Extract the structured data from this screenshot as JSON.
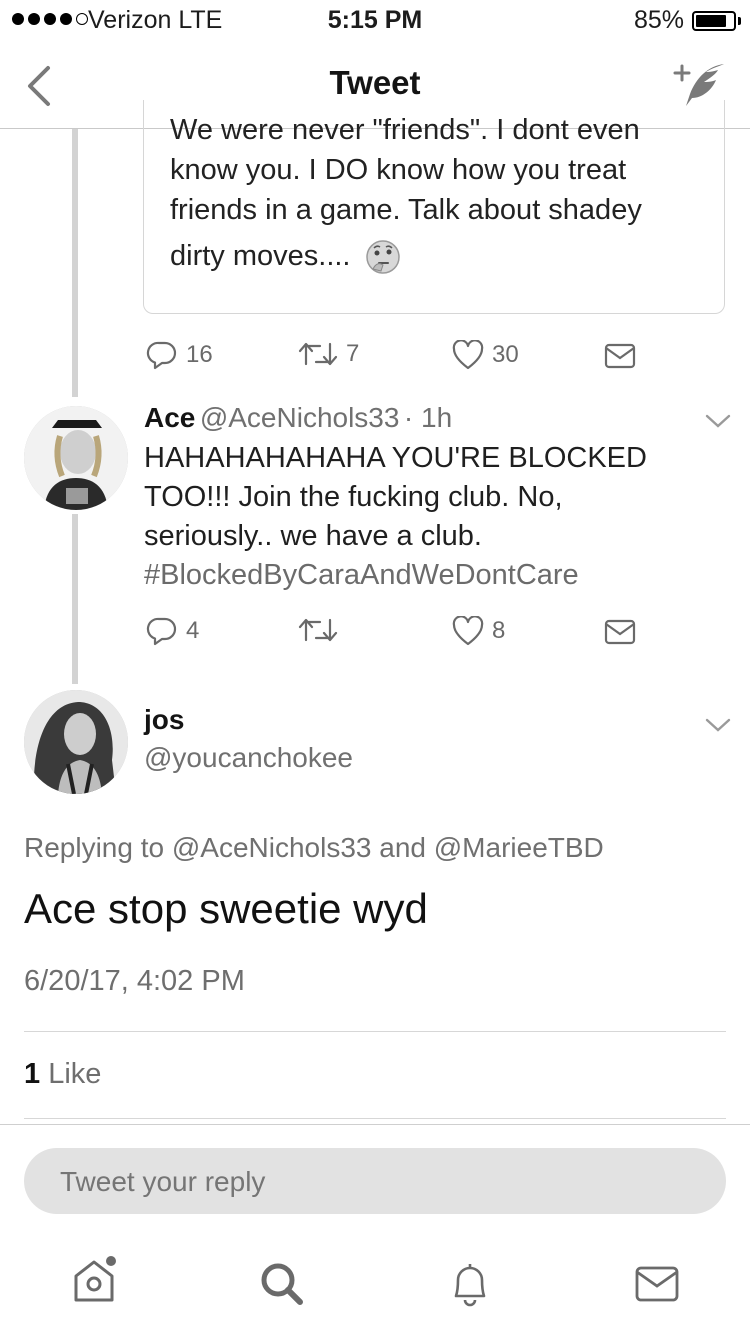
{
  "status_bar": {
    "carrier": "Verizon  LTE",
    "time": "5:15 PM",
    "battery": "85%",
    "battery_level": 0.85
  },
  "nav": {
    "title": "Tweet"
  },
  "quoted": {
    "lines": [
      "We were never \"friends\". I dont even",
      "know you. I DO know how you treat",
      "friends in a game. Talk about shadey",
      "dirty moves...."
    ],
    "replies": "16",
    "retweets": "7",
    "likes": "30"
  },
  "tweet_ace": {
    "name": "Ace",
    "handle": "@AceNichols33",
    "time": "· 1h",
    "lines": [
      "HAHAHAHAHAHA YOU'RE BLOCKED",
      "TOO!!! Join the fucking club. No,",
      "seriously.. we have a club."
    ],
    "hashtag": "#BlockedByCaraAndWeDontCare",
    "replies": "4",
    "retweets": "",
    "likes": "8"
  },
  "tweet_focal": {
    "name": "jos",
    "handle": "@youcanchokee",
    "replying_to": "Replying to @AceNichols33 and @MarieeTBD",
    "text": "Ace stop sweetie wyd",
    "date": "6/20/17, 4:02 PM",
    "like_count": "1",
    "like_label": " Like"
  },
  "reply": {
    "placeholder": "Tweet your reply"
  },
  "tabs": [
    "home-icon",
    "search-icon",
    "notifications-icon",
    "messages-icon"
  ]
}
